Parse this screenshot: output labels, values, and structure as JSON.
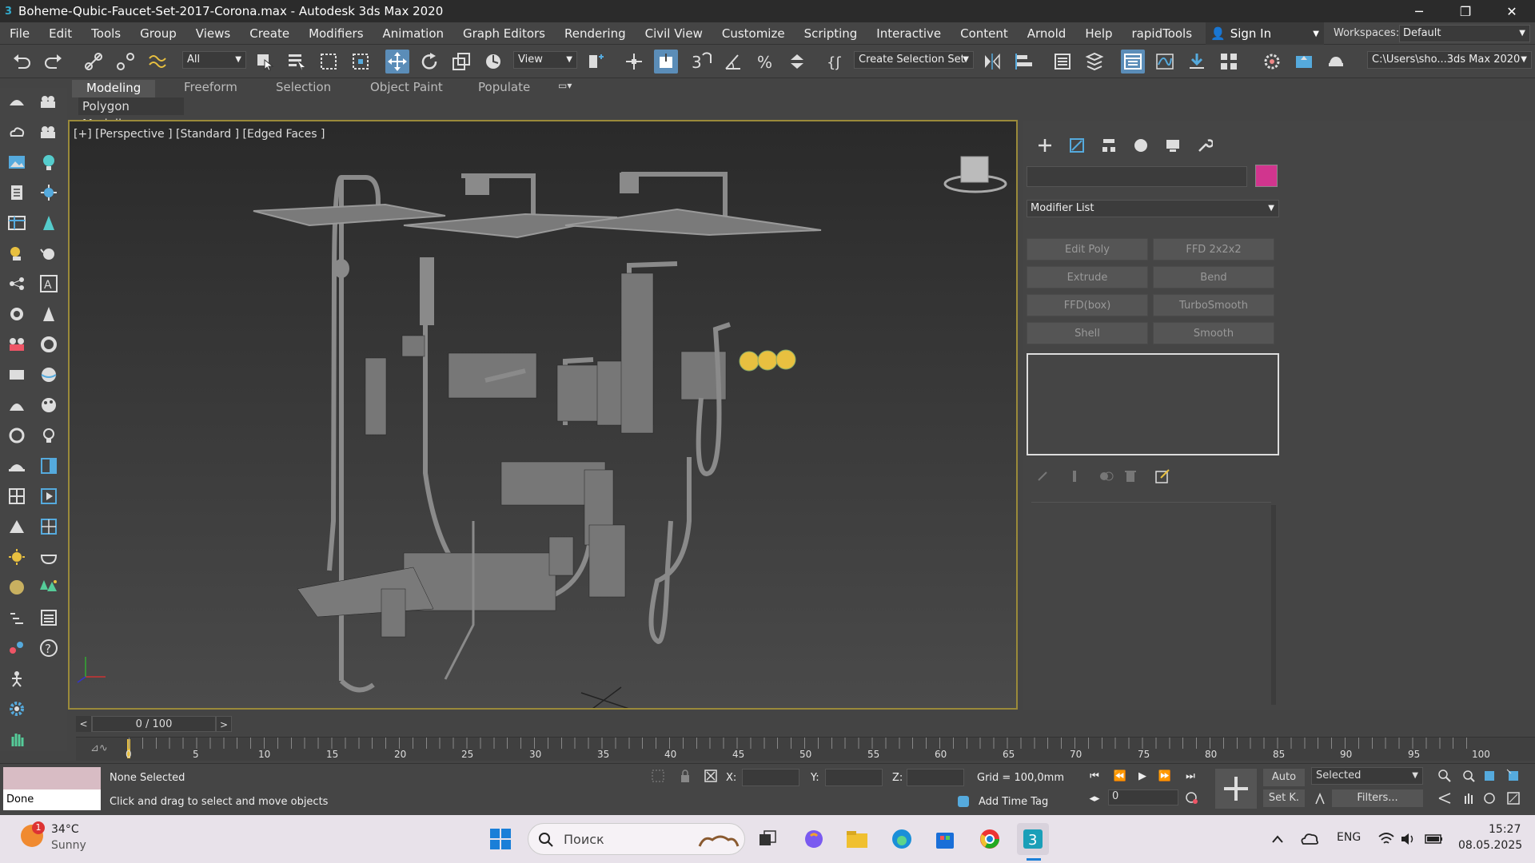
{
  "window": {
    "title": "Boheme-Qubic-Faucet-Set-2017-Corona.max - Autodesk 3ds Max 2020",
    "minimize": "─",
    "maximize": "❐",
    "close": "✕"
  },
  "menu": [
    "File",
    "Edit",
    "Tools",
    "Group",
    "Views",
    "Create",
    "Modifiers",
    "Animation",
    "Graph Editors",
    "Rendering",
    "Civil View",
    "Customize",
    "Scripting",
    "Interactive",
    "Content",
    "Arnold",
    "Help",
    "rapidTools"
  ],
  "account": {
    "signin": "Sign In"
  },
  "workspaces": {
    "label": "Workspaces:",
    "value": "Default"
  },
  "toolbar": {
    "filter_value": "All",
    "refcoord_value": "View",
    "selection_set": "Create Selection Set",
    "project_path": "C:\\Users\\sho...3ds Max 2020"
  },
  "ribbon": {
    "tabs": [
      "Modeling",
      "Freeform",
      "Selection",
      "Object Paint",
      "Populate"
    ],
    "active_tab": "Modeling",
    "panel": "Polygon Modeling"
  },
  "viewport": {
    "label": "[+] [Perspective ] [Standard ] [Edged Faces ]"
  },
  "command_panel": {
    "object_name": "",
    "object_color": "#d1358e",
    "modifier_list": "Modifier List",
    "modifier_buttons": [
      "Edit Poly",
      "FFD 2x2x2",
      "Extrude",
      "Bend",
      "FFD(box)",
      "TurboSmooth",
      "Shell",
      "Smooth"
    ]
  },
  "timeline": {
    "frame_display": "0 / 100",
    "prev": "<",
    "next": ">",
    "ticks": [
      "0",
      "5",
      "10",
      "15",
      "20",
      "25",
      "30",
      "35",
      "40",
      "45",
      "50",
      "55",
      "60",
      "65",
      "70",
      "75",
      "80",
      "85",
      "90",
      "95",
      "100"
    ]
  },
  "status": {
    "maxscript_output": "Done",
    "selection": "None Selected",
    "prompt": "Click and drag to select and move objects",
    "x_label": "X:",
    "y_label": "Y:",
    "z_label": "Z:",
    "grid": "Grid = 100,0mm",
    "add_time_tag": "Add Time Tag",
    "auto_key": "Auto",
    "set_key": "Set K.",
    "key_filter_value": "Selected",
    "filters": "Filters...",
    "frame_value": "0"
  },
  "taskbar": {
    "weather_temp": "34°C",
    "weather_desc": "Sunny",
    "weather_badge": "1",
    "search_placeholder": "Поиск",
    "language": "ENG",
    "time": "15:27",
    "date": "08.05.2025"
  }
}
